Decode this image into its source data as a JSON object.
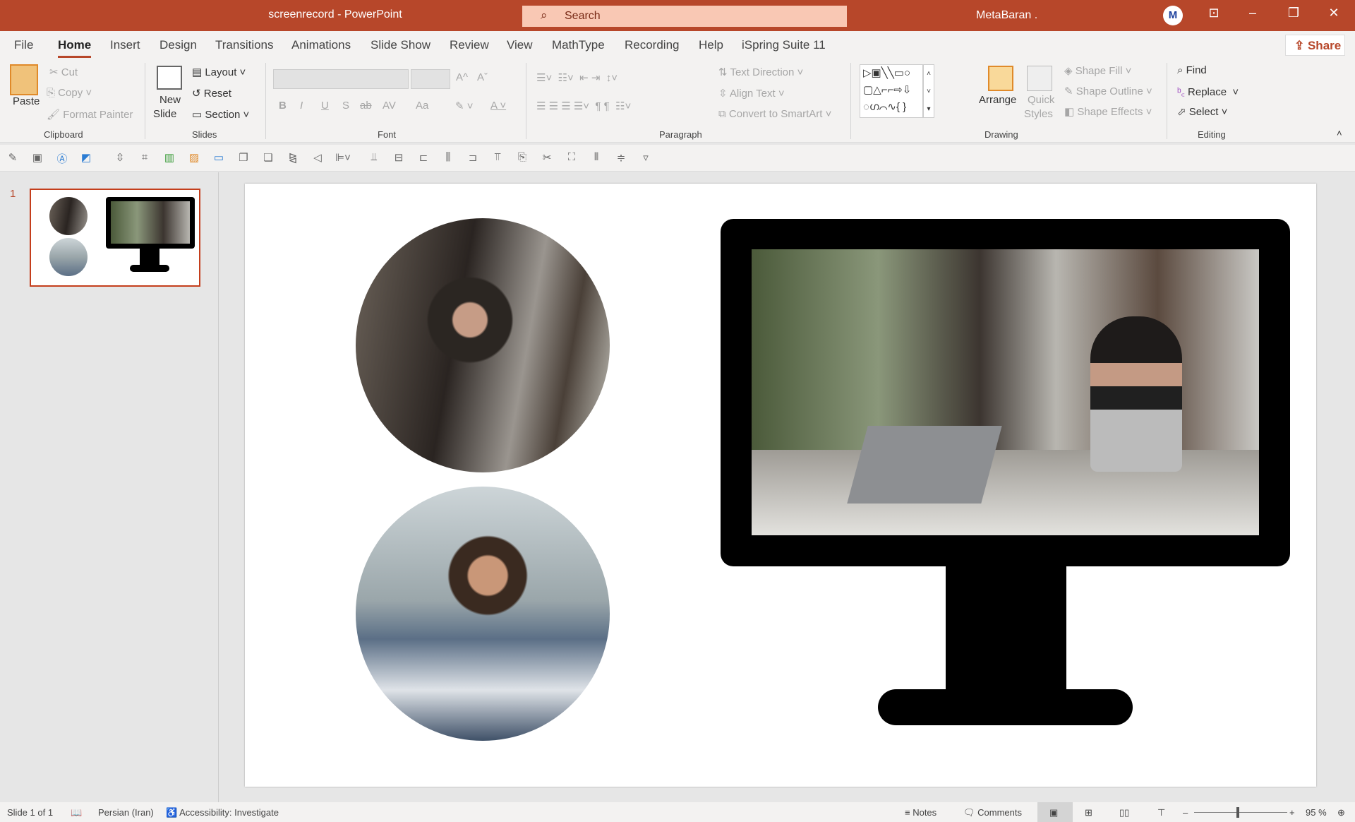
{
  "titlebar": {
    "title": "screenrecord  -  PowerPoint",
    "search_placeholder": "Search",
    "user": "MetaBaran .",
    "avatar_text": "M",
    "minimize": "–",
    "restore": "❐",
    "close": "✕",
    "ribbon_display": "⊡"
  },
  "tabs": [
    "File",
    "Home",
    "Insert",
    "Design",
    "Transitions",
    "Animations",
    "Slide Show",
    "Review",
    "View",
    "MathType",
    "Recording",
    "Help",
    "iSpring Suite 11"
  ],
  "share_label": "Share",
  "ribbon": {
    "clipboard": {
      "paste": "Paste",
      "cut": "Cut",
      "copy": "Copy",
      "format_painter": "Format Painter",
      "label": "Clipboard"
    },
    "slides": {
      "new_slide": "New",
      "new_slide2": "Slide",
      "layout": "Layout",
      "reset": "Reset",
      "section": "Section",
      "label": "Slides"
    },
    "font": {
      "label": "Font",
      "bold": "B",
      "italic": "I",
      "underline": "U",
      "shadow": "S",
      "strike": "ab",
      "spacing": "AV",
      "case": "Aa",
      "grow": "A^",
      "shrink": "Aˇ"
    },
    "paragraph": {
      "label": "Paragraph",
      "text_direction": "Text Direction",
      "align_text": "Align Text",
      "smartart": "Convert to SmartArt"
    },
    "drawing": {
      "label": "Drawing",
      "arrange": "Arrange",
      "quick": "Quick",
      "styles": "Styles",
      "shape_fill": "Shape Fill",
      "shape_outline": "Shape Outline",
      "shape_effects": "Shape Effects"
    },
    "editing": {
      "label": "Editing",
      "find": "Find",
      "replace": "Replace",
      "select": "Select"
    }
  },
  "slide_pane": {
    "number": "1"
  },
  "status": {
    "slide": "Slide 1 of 1",
    "language": "Persian (Iran)",
    "accessibility": "Accessibility: Investigate",
    "notes": "Notes",
    "comments": "Comments",
    "zoom": "95 %",
    "zoom_percent": 95
  },
  "colors": {
    "accent": "#b7472a"
  }
}
